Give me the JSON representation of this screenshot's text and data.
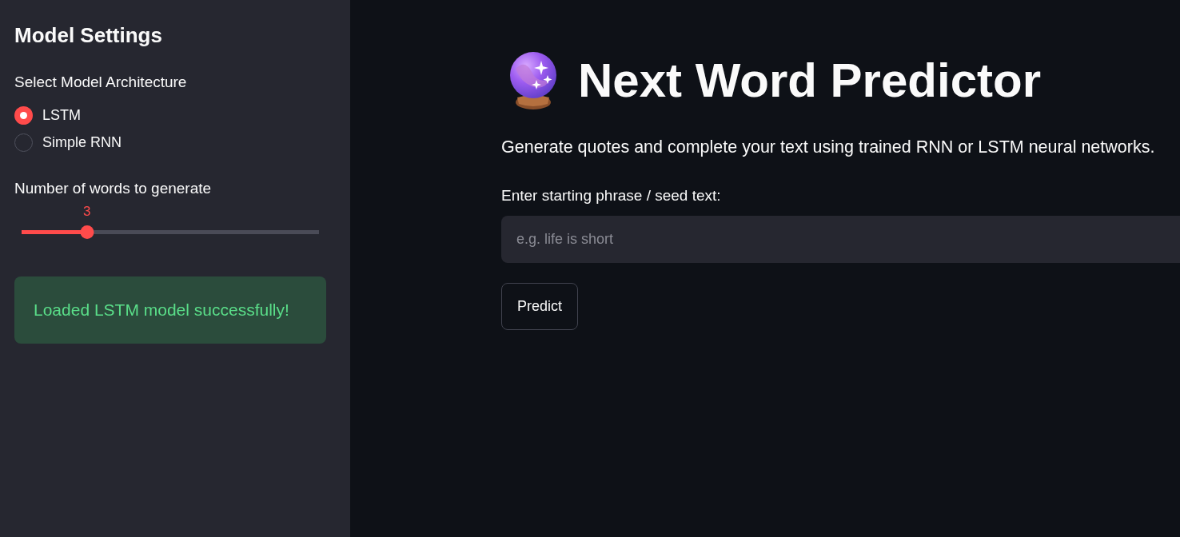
{
  "sidebar": {
    "title": "Model Settings",
    "architecture": {
      "label": "Select Model Architecture",
      "options": [
        {
          "label": "LSTM",
          "selected": true
        },
        {
          "label": "Simple RNN",
          "selected": false
        }
      ]
    },
    "words_slider": {
      "label": "Number of words to generate",
      "value": "3",
      "level": 0.22
    },
    "alert": {
      "kind": "success",
      "message": "Loaded LSTM model successfully!"
    }
  },
  "main": {
    "title": "Next Word Predictor",
    "subtitle": "Generate quotes and complete your text using trained RNN or LSTM neural networks.",
    "seed_input": {
      "label": "Enter starting phrase / seed text:",
      "placeholder": "e.g. life is short"
    },
    "buttons": [
      "Predict"
    ]
  }
}
